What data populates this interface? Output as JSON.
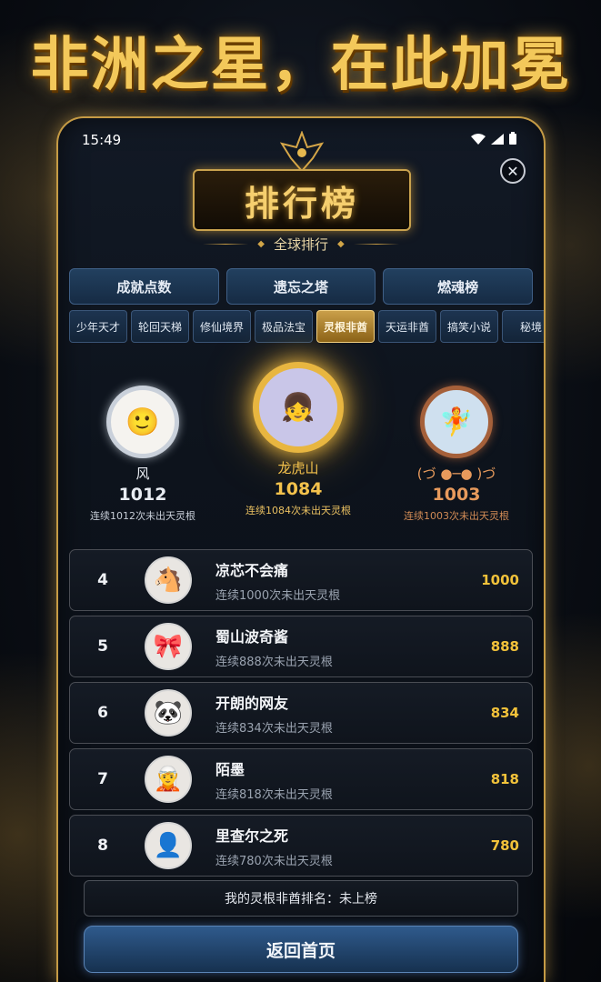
{
  "banner": {
    "title": "非洲之星，在此加冕"
  },
  "status_bar": {
    "time": "15:49"
  },
  "header": {
    "title": "排行榜",
    "subtitle": "全球排行",
    "close_icon": "close-icon"
  },
  "main_tabs": [
    {
      "label": "成就点数"
    },
    {
      "label": "遗忘之塔"
    },
    {
      "label": "燃魂榜"
    }
  ],
  "sub_tabs": [
    {
      "label": "少年天才",
      "active": false
    },
    {
      "label": "轮回天梯",
      "active": false
    },
    {
      "label": "修仙境界",
      "active": false
    },
    {
      "label": "极品法宝",
      "active": false
    },
    {
      "label": "灵根非酋",
      "active": true
    },
    {
      "label": "天运非酋",
      "active": false
    },
    {
      "label": "搞笑小说",
      "active": false
    },
    {
      "label": "秘境",
      "active": false
    }
  ],
  "podium": {
    "first": {
      "name": "龙虎山",
      "score": "1084",
      "desc": "连续1084次未出天灵根"
    },
    "second": {
      "name": "风",
      "score": "1012",
      "desc": "连续1012次未出天灵根"
    },
    "third": {
      "name": "(づ ●─● )づ",
      "score": "1003",
      "desc": "连续1003次未出天灵根"
    }
  },
  "ranks": [
    {
      "rank": "4",
      "name": "凉芯不会痛",
      "desc": "连续1000次未出天灵根",
      "score": "1000"
    },
    {
      "rank": "5",
      "name": "蜀山波奇酱",
      "desc": "连续888次未出天灵根",
      "score": "888"
    },
    {
      "rank": "6",
      "name": "开朗的网友",
      "desc": "连续834次未出天灵根",
      "score": "834"
    },
    {
      "rank": "7",
      "name": "陌墨",
      "desc": "连续818次未出天灵根",
      "score": "818"
    },
    {
      "rank": "8",
      "name": "里查尔之死",
      "desc": "连续780次未出天灵根",
      "score": "780"
    }
  ],
  "my_rank": {
    "text": "我的灵根非酋排名：未上榜"
  },
  "home_button": {
    "label": "返回首页"
  },
  "colors": {
    "gold": "#f2c23a",
    "silver": "#c9d0da",
    "bronze": "#a5603a",
    "accent_blue": "#2f5a8c"
  }
}
